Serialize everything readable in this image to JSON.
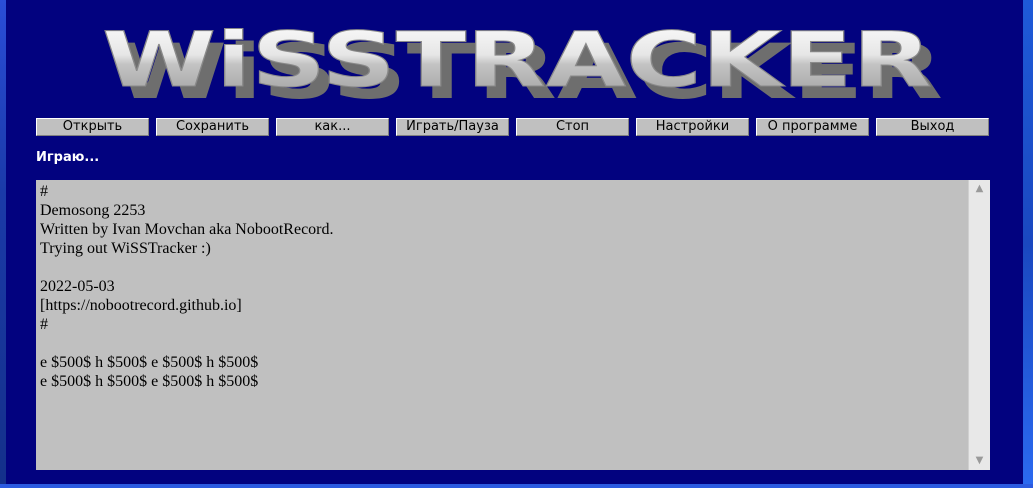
{
  "app": {
    "logo_text": "WiSSTRACKER",
    "status": "Играю..."
  },
  "toolbar": {
    "open": "Открыть",
    "save": "Сохранить",
    "save_as": "как...",
    "play_pause": "Играть/Пауза",
    "stop": "Стоп",
    "settings": "Настройки",
    "about": "О программе",
    "exit": "Выход"
  },
  "editor": {
    "content": "#\nDemosong 2253\nWritten by Ivan Movchan aka NobootRecord.\nTrying out WiSSTracker :)\n\n2022-05-03\n[https://nobootrecord.github.io]\n#\n\ne $500$ h $500$ e $500$ h $500$\ne $500$ h $500$ e $500$ h $500$"
  },
  "scrollbar": {
    "up_glyph": "▲",
    "down_glyph": "▼"
  },
  "colors": {
    "window_bg": "#02027f",
    "control_bg": "#c0c0c0",
    "status_text": "#ffffff"
  }
}
